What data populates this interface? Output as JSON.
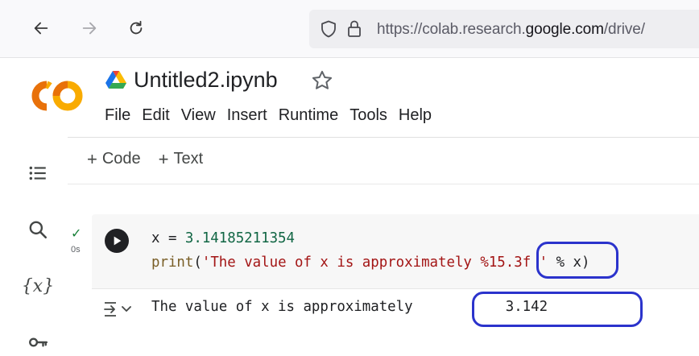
{
  "browser": {
    "url_prefix": "https://colab.research.",
    "url_domain": "google.com",
    "url_suffix": "/drive/"
  },
  "notebook": {
    "title": "Untitled2.ipynb"
  },
  "menu": [
    "File",
    "Edit",
    "View",
    "Insert",
    "Runtime",
    "Tools",
    "Help"
  ],
  "toolbar": {
    "plus": "+",
    "code_label": "Code",
    "text_label": "Text"
  },
  "sidebar": {
    "variables_label": "{x}"
  },
  "cell": {
    "exec_mark": "✓",
    "exec_time": "0s",
    "line1": {
      "var": "x = ",
      "num": "3.14185211354"
    },
    "line2": {
      "fn": "print",
      "open": "(",
      "str": "'The value of x is approximately %15.3f '",
      "rest": " % x)"
    },
    "output": "The value of x is approximately           3.142"
  },
  "colors": {
    "annotation": "#2b33cc",
    "colab_orange": "#f9ab00",
    "colab_dark_orange": "#e8710a"
  }
}
